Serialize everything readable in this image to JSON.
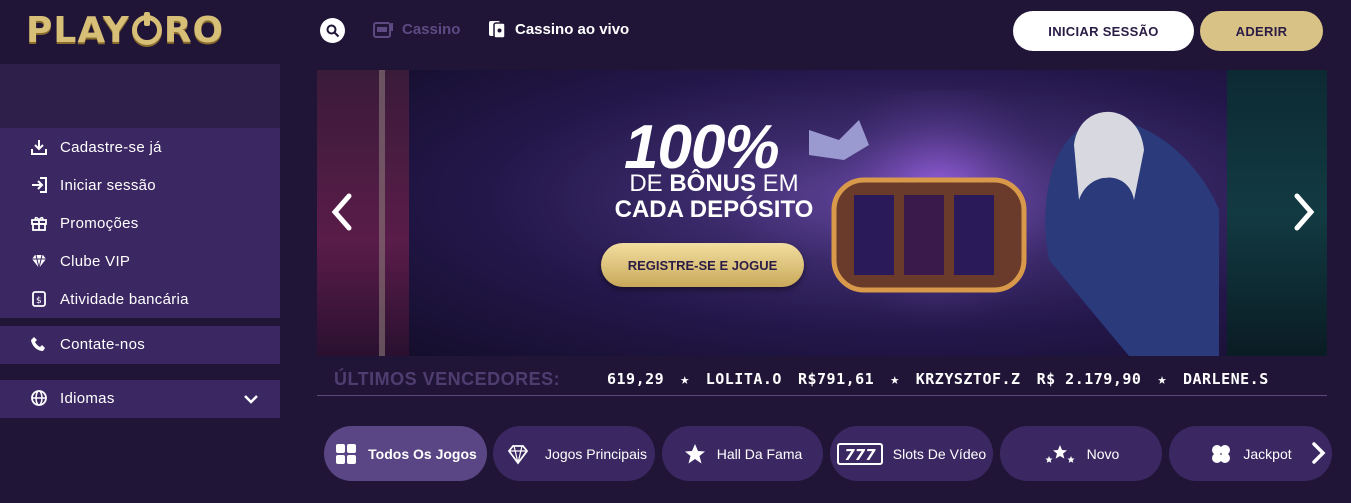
{
  "header": {
    "logo_text": "PLAYORO",
    "nav": [
      {
        "label": "Cassino",
        "icon": "slot-machine-icon"
      },
      {
        "label": "Cassino ao vivo",
        "icon": "cards-icon"
      }
    ],
    "login_label": "INICIAR SESSÃO",
    "join_label": "ADERIR"
  },
  "sidebar": {
    "items": [
      {
        "label": "Cadastre-se já",
        "icon": "download-icon"
      },
      {
        "label": "Iniciar sessão",
        "icon": "login-icon"
      },
      {
        "label": "Promoções",
        "icon": "gift-icon"
      },
      {
        "label": "Clube VIP",
        "icon": "diamond-icon"
      },
      {
        "label": "Atividade bancária",
        "icon": "money-icon"
      }
    ],
    "contact_label": "Contate-nos",
    "language_label": "Idiomas"
  },
  "banner": {
    "big_text": "100%",
    "line1_bold": "BÔNUS",
    "line1_pre": "DE",
    "line1_post": "EM",
    "line2": "CADA DEPÓSITO",
    "cta_label": "REGISTRE-SE E JOGUE"
  },
  "winners": {
    "label": "ÚLTIMOS VENCEDORES:",
    "entries": [
      "619,29",
      "LOLITA.O",
      "R$791,61",
      "KRZYSZTOF.Z",
      "R$ 2.179,90",
      "DARLENE.S"
    ]
  },
  "categories": [
    {
      "label": "Todos Os Jogos",
      "icon": "grid-icon",
      "active": true
    },
    {
      "label": "Jogos Principais",
      "icon": "diamond-icon",
      "active": false
    },
    {
      "label": "Hall Da Fama",
      "icon": "star-icon",
      "active": false
    },
    {
      "label": "Slots De Vídeo",
      "icon": "777-icon",
      "active": false
    },
    {
      "label": "Novo",
      "icon": "stars-icon",
      "active": false
    },
    {
      "label": "Jackpot",
      "icon": "clover-icon",
      "active": false
    }
  ],
  "colors": {
    "background": "#211537",
    "sidebar": "#3b2862",
    "gold": "#d9c285",
    "accent_active": "#5a4685"
  }
}
